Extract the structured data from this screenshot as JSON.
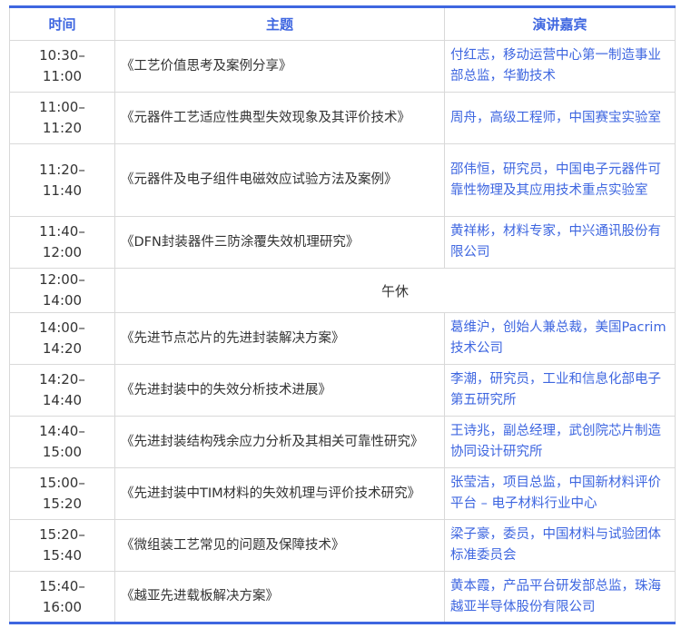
{
  "headers": {
    "time": "时间",
    "topic": "主题",
    "speaker": "演讲嘉宾"
  },
  "colors": {
    "accent": "#3e66e0",
    "text": "#333333",
    "border": "#d9d9d9"
  },
  "rows": [
    {
      "start": "10:30–",
      "end": "11:00",
      "topic": "《工艺价值思考及案例分享》",
      "speaker": "付红志，移动运营中心第一制造事业部总监，华勤技术"
    },
    {
      "start": "11:00–",
      "end": "11:20",
      "topic": "《元器件工艺适应性典型失效现象及其评价技术》",
      "speaker": "周舟，高级工程师，中国赛宝实验室"
    },
    {
      "start": "11:20–",
      "end": "11:40",
      "topic": "《元器件及电子组件电磁效应试验方法及案例》",
      "speaker": "邵伟恒，研究员，中国电子元器件可靠性物理及其应用技术重点实验室"
    },
    {
      "start": "11:40–",
      "end": "12:00",
      "topic": "《DFN封装器件三防涂覆失效机理研究》",
      "speaker": "黄祥彬，材料专家，中兴通讯股份有限公司"
    },
    {
      "start": "12:00–",
      "end": "14:00",
      "topic": "午休",
      "speaker": ""
    },
    {
      "start": "14:00–",
      "end": "14:20",
      "topic": "《先进节点芯片的先进封装解决方案》",
      "speaker": "葛维沪，创始人兼总裁，美国Pacrim技术公司"
    },
    {
      "start": "14:20–",
      "end": "14:40",
      "topic": "《先进封装中的失效分析技术进展》",
      "speaker": "李潮，研究员，工业和信息化部电子第五研究所"
    },
    {
      "start": "14:40–",
      "end": "15:00",
      "topic": "《先进封装结构残余应力分析及其相关可靠性研究》",
      "speaker": "王诗兆，副总经理，武创院芯片制造协同设计研究所"
    },
    {
      "start": "15:00–",
      "end": "15:20",
      "topic": "《先进封装中TIM材料的失效机理与评价技术研究》",
      "speaker": "张莹洁，项目总监，中国新材料评价平台 – 电子材料行业中心"
    },
    {
      "start": "15:20–",
      "end": "15:40",
      "topic": "《微组装工艺常见的问题及保障技术》",
      "speaker": "梁子豪，委员，中国材料与试验团体标准委员会"
    },
    {
      "start": "15:40–",
      "end": "16:00",
      "topic": "《越亚先进载板解决方案》",
      "speaker": "黄本霞，产品平台研发部总监，珠海越亚半导体股份有限公司"
    }
  ]
}
